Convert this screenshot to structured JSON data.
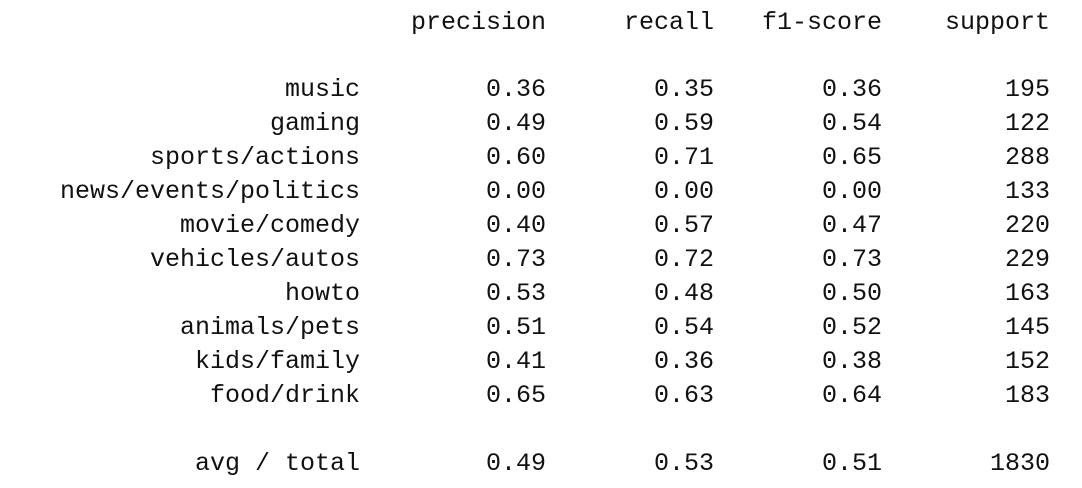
{
  "chart_data": {
    "type": "table",
    "columns": [
      "precision",
      "recall",
      "f1-score",
      "support"
    ],
    "rows": [
      {
        "label": "music",
        "precision": "0.36",
        "recall": "0.35",
        "f1": "0.36",
        "support": "195"
      },
      {
        "label": "gaming",
        "precision": "0.49",
        "recall": "0.59",
        "f1": "0.54",
        "support": "122"
      },
      {
        "label": "sports/actions",
        "precision": "0.60",
        "recall": "0.71",
        "f1": "0.65",
        "support": "288"
      },
      {
        "label": "news/events/politics",
        "precision": "0.00",
        "recall": "0.00",
        "f1": "0.00",
        "support": "133"
      },
      {
        "label": "movie/comedy",
        "precision": "0.40",
        "recall": "0.57",
        "f1": "0.47",
        "support": "220"
      },
      {
        "label": "vehicles/autos",
        "precision": "0.73",
        "recall": "0.72",
        "f1": "0.73",
        "support": "229"
      },
      {
        "label": "howto",
        "precision": "0.53",
        "recall": "0.48",
        "f1": "0.50",
        "support": "163"
      },
      {
        "label": "animals/pets",
        "precision": "0.51",
        "recall": "0.54",
        "f1": "0.52",
        "support": "145"
      },
      {
        "label": "kids/family",
        "precision": "0.41",
        "recall": "0.36",
        "f1": "0.38",
        "support": "152"
      },
      {
        "label": "food/drink",
        "precision": "0.65",
        "recall": "0.63",
        "f1": "0.64",
        "support": "183"
      }
    ],
    "total": {
      "label": "avg / total",
      "precision": "0.49",
      "recall": "0.53",
      "f1": "0.51",
      "support": "1830"
    }
  }
}
